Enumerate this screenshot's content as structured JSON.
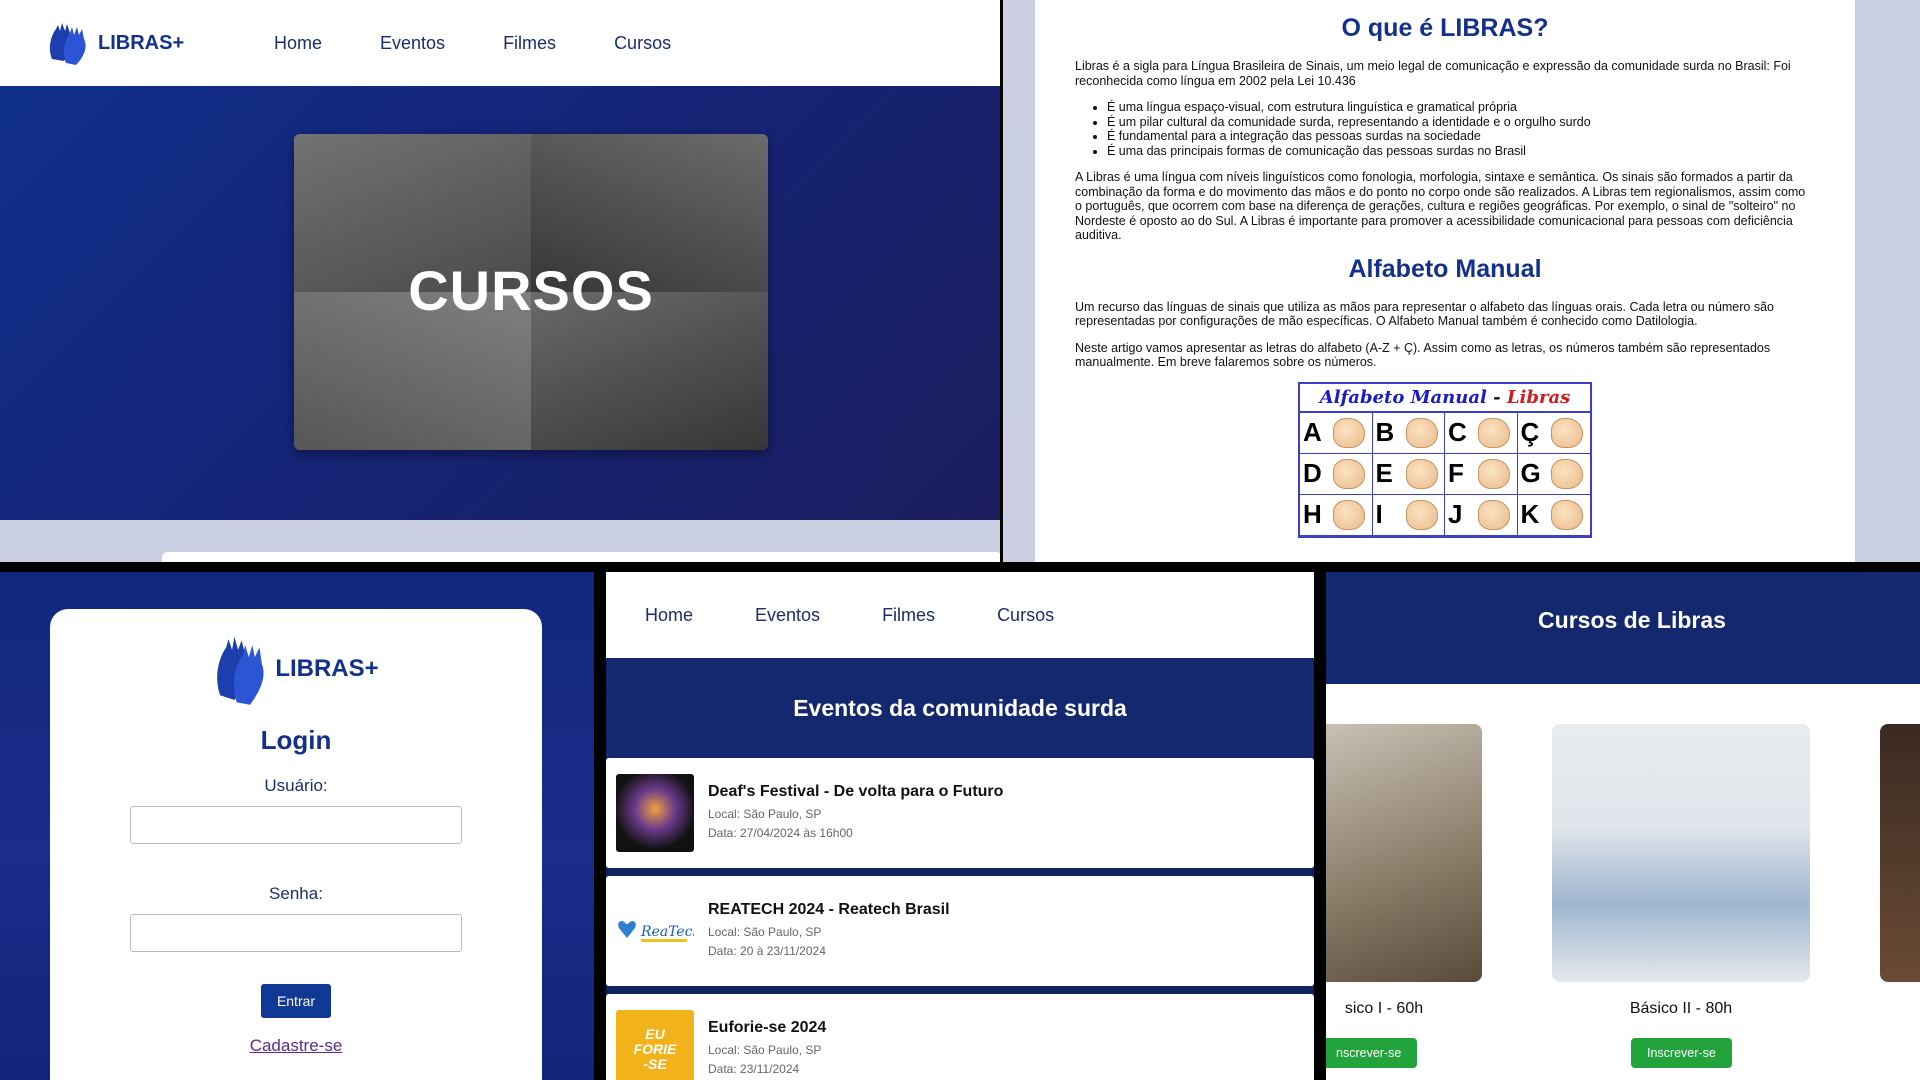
{
  "brand": {
    "logo_text": "LIBRAS+",
    "primary_color": "#12308c",
    "accent_green": "#22a33c"
  },
  "nav": {
    "items": [
      "Home",
      "Eventos",
      "Filmes",
      "Cursos"
    ]
  },
  "home": {
    "hero_title": "CURSOS"
  },
  "article": {
    "title": "O que é LIBRAS?",
    "intro": "Libras é a sigla para Língua Brasileira de Sinais, um meio legal de comunicação e expressão da comunidade surda no Brasil: Foi reconhecida como língua em 2002 pela Lei 10.436",
    "bullets": [
      "É uma língua espaço-visual, com estrutura linguística e gramatical própria",
      "É um pilar cultural da comunidade surda, representando a identidade e o orgulho surdo",
      "É fundamental para a integração das pessoas surdas na sociedade",
      "É uma das principais formas de comunicação das pessoas surdas no Brasil"
    ],
    "body": "A Libras é uma língua com níveis linguísticos como fonologia, morfologia, sintaxe e semântica. Os sinais são formados a partir da combinação da forma e do movimento das mãos e do ponto no corpo onde são realizados. A Libras tem regionalismos, assim como o português, que ocorrem com base na diferença de gerações, cultura e regiões geográficas. Por exemplo, o sinal de \"solteiro\" no Nordeste é oposto ao do Sul. A Libras é importante para promover a acessibilidade comunicacional para pessoas com deficiência auditiva.",
    "alphabet_title": "Alfabeto Manual",
    "alphabet_p1": "Um recurso das línguas de sinais que utiliza as mãos para representar o alfabeto das línguas orais. Cada letra ou número são representadas por configurações de mão específicas. O Alfabeto Manual também é conhecido como Datilologia.",
    "alphabet_p2": "Neste artigo vamos apresentar as letras do alfabeto (A-Z + Ç). Assim como as letras, os números também são representados manualmente. Em breve falaremos sobre os números.",
    "chart_title_a": "Alfabeto Manual",
    "chart_title_sep": " - ",
    "chart_title_b": "Libras",
    "letters": [
      "A",
      "B",
      "C",
      "Ç",
      "D",
      "E",
      "F",
      "G",
      "H",
      "I",
      "J",
      "K"
    ]
  },
  "login": {
    "title": "Login",
    "user_label": "Usuário:",
    "pass_label": "Senha:",
    "submit": "Entrar",
    "register": "Cadastre-se"
  },
  "events": {
    "header": "Eventos da comunidade surda",
    "items": [
      {
        "title": "Deaf's Festival - De volta para o Futuro",
        "location": "Local: São Paulo, SP",
        "date": "Data: 27/04/2024 às 16h00",
        "thumb_color": "#1b1b1b"
      },
      {
        "title": "REATECH 2024 - Reatech Brasil",
        "location": "Local: São Paulo, SP",
        "date": "Data: 20 à 23/11/2024",
        "thumb_color": "#ffffff"
      },
      {
        "title": "Euforie-se 2024",
        "location": "Local: São Paulo, SP",
        "date": "Data: 23/11/2024",
        "thumb_color": "#f2b21a"
      }
    ]
  },
  "courses": {
    "header": "Cursos de Libras",
    "items": [
      {
        "name": "sico I - 60h",
        "button": "nscrever-se"
      },
      {
        "name": "Básico II - 80h",
        "button": "Inscrever-se"
      }
    ]
  }
}
